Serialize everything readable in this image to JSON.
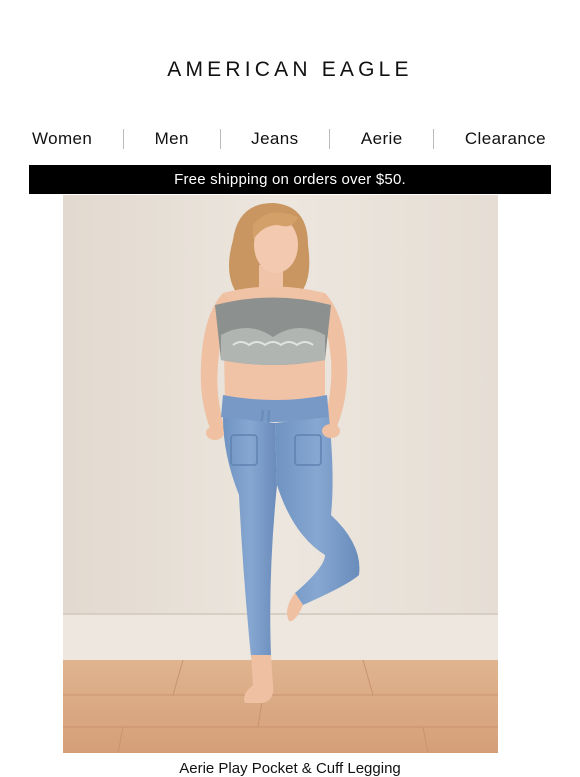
{
  "brand": {
    "logo_text": "AMERICAN EAGLE"
  },
  "nav": {
    "items": [
      {
        "label": "Women"
      },
      {
        "label": "Men"
      },
      {
        "label": "Jeans"
      },
      {
        "label": "Aerie"
      },
      {
        "label": "Clearance"
      }
    ]
  },
  "banner": {
    "text": "Free shipping on orders over $50."
  },
  "product": {
    "name": "Aerie Play Pocket & Cuff Legging",
    "image": "model-in-lace-bralette-and-blue-jogger-leggings"
  }
}
